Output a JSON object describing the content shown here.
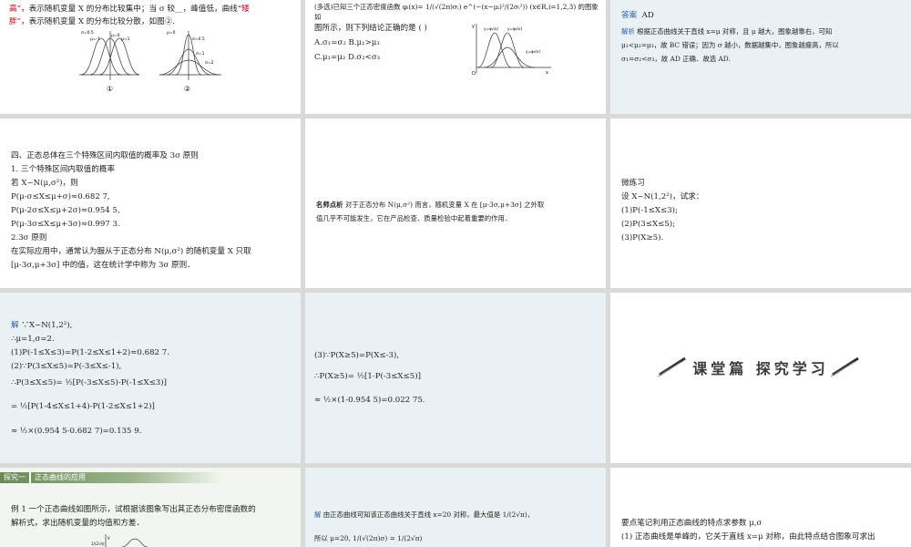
{
  "r1c1": {
    "line1_a": "高”",
    "line1_b": "，表示随机变量 X 的分布比较集中；当 σ 较",
    "line1_blank": "__",
    "line1_c": "，峰值低，曲线“",
    "line1_d": "矮",
    "line2_a": "胖”",
    "line2_b": "，表示随机变量 X 的分布比较分散，如图②.",
    "fig1_label": "①",
    "fig2_label": "②",
    "fig1_sigma": "σ=0.5",
    "fig1_mu_m1": "μ=-1",
    "fig1_mu_0": "μ=0",
    "fig1_mu_1": "μ=1",
    "fig2_mu": "μ=0",
    "fig2_s05": "σ=0.5",
    "fig2_s1": "σ=1",
    "fig2_s2": "σ=2"
  },
  "r1c2": {
    "line1": "(多选)已知三个正态密度函数 φᵢ(x)= 1/(√(2π)σᵢ) e^(−(x−μᵢ)²/(2σᵢ²)) (x∈R,i=1,2,3) 的图象如",
    "line2": "图所示，则下列结论正确的是 (     )",
    "optA": "A.σ₁=σ₂ B.μ₁>μ₃",
    "optC": "C.μ₁=μ₂ D.σ₂<σ₃",
    "g_l1": "y=φ₁(x)",
    "g_l2": "y=φ₂(x)",
    "g_l3": "y=φ₃(x)",
    "axis_o": "O",
    "axis_x": "x",
    "axis_y": "y"
  },
  "r1c3": {
    "answer_label": "答案",
    "answer": "AD",
    "analysis_label": "解析",
    "a1": "根据正态曲线关于直线 x=μ 对称，且 μ 越大，图象越靠右，可知",
    "a2": "μ₁<μ₂=μ₃，故 BC 错误；因为 σ 越小，数据越集中，图象越瘦高，所以",
    "a3": "σ₁=σ₂<σ₃，故 AD 正确．故选 AD."
  },
  "r2c1": {
    "h": "四、正态总体在三个特殊区间内取值的概率及 3σ 原则",
    "s1": "1. 三个特殊区间内取值的概率",
    "l1": "若 X~N(μ,σ²)，则",
    "l2": "P(μ-σ≤X≤μ+σ)≈0.682 7,",
    "l3": "P(μ-2σ≤X≤μ+2σ)≈0.954 5,",
    "l4": "P(μ-3σ≤X≤μ+3σ)≈0.997 3.",
    "s2": "2.3σ 原则",
    "l5": "在实际应用中，通常认为服从于正态分布 N(μ,σ²) 的随机变量 X 只取",
    "l6": "[μ-3σ,μ+3σ] 中的值，这在统计学中称为 3σ 原则．"
  },
  "r2c2": {
    "label": "名师点析",
    "l1": "对于正态分布 N(μ,σ²) 而言，随机变量 X 在 [μ-3σ,μ+3σ] 之外取",
    "l2": "值几乎不可能发生，它在产品检查、质量检验中起着重要的作用．"
  },
  "r2c3": {
    "h": "微练习",
    "l1": "设 X~N(1,2²)，试求：",
    "l2": "(1)P(-1≤X≤3);",
    "l3": "(2)P(3≤X≤5);",
    "l4": "(3)P(X≥5)."
  },
  "r3c1": {
    "label": "解",
    "l1": "∵X~N(1,2²),",
    "l2": "∴μ=1,σ=2.",
    "l3": "(1)P(-1≤X≤3)=P(1-2≤X≤1+2)≈0.682 7.",
    "l4": "(2)∵P(3≤X≤5)=P(-3≤X≤-1),",
    "l5": "∴P(3≤X≤5)= ½[P(-3≤X≤5)-P(-1≤X≤3)]",
    "l6": "= ½[P(1-4≤X≤1+4)-P(1-2≤X≤1+2)]",
    "l7": "≈ ½×(0.954 5-0.682 7)=0.135 9."
  },
  "r3c2": {
    "l1": "(3)∵P(X≥5)=P(X≤-3),",
    "l2": "∴P(X≥5)= ½[1-P(-3≤X≤5)]",
    "l3": "≈ ½×(1-0.954 5)=0.022 75."
  },
  "r3c3": {
    "title": "课堂篇 探究学习"
  },
  "r4c1": {
    "tag1": "探究一",
    "tag2": "正态曲线的应用",
    "l1": "例 1 一个正态曲线如图所示，试根据该图象写出其正态分布密度函数的",
    "l2": "解析式，求出随机变量的均值和方差．",
    "fig_y": "y",
    "fig_val": "1/(2√π)"
  },
  "r4c2": {
    "label": "解",
    "l1": "由正态曲线可知该正态曲线关于直线 x=20 对称，最大值是 1/(2√π)，",
    "l2": "所以 μ=20, 1/(√(2π)σ) = 1/(2√π)"
  },
  "r4c3": {
    "l1": "要点笔记利用正态曲线的特点求参数 μ,σ",
    "l2": "(1) 正态曲线是单峰的，它关于直线 x=μ 对称，由此特点结合图象可求出"
  }
}
